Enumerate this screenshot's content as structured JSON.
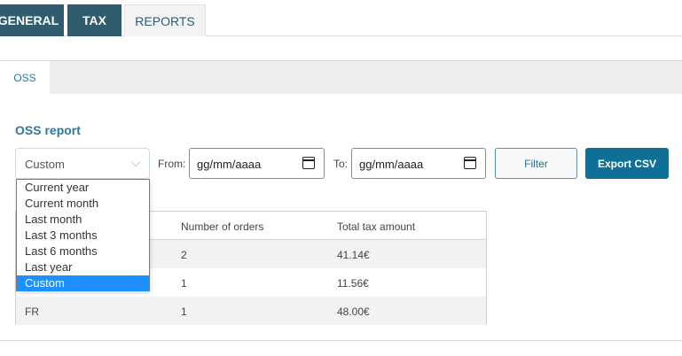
{
  "top_tabs": {
    "general": "GENERAL",
    "tax": "TAX",
    "reports": "REPORTS"
  },
  "sub_tabs": {
    "oss": "OSS"
  },
  "report": {
    "title": "OSS report",
    "period": {
      "selected": "Custom",
      "options": [
        "Current year",
        "Current month",
        "Last month",
        "Last 3 months",
        "Last 6 months",
        "Last year",
        "Custom"
      ]
    },
    "from_label": "From:",
    "from_value": "gg/mm/aaaa",
    "to_label": "To:",
    "to_value": "gg/mm/aaaa",
    "filter_label": "Filter",
    "export_label": "Export CSV"
  },
  "table": {
    "columns": [
      "",
      "Number of orders",
      "Total tax amount"
    ],
    "rows": [
      [
        "",
        "2",
        "41.14€"
      ],
      [
        "",
        "1",
        "11.56€"
      ],
      [
        "FR",
        "1",
        "48.00€"
      ]
    ]
  },
  "colors": {
    "tab_dark": "#2f5d6e",
    "accent": "#2a7aa0",
    "export_button": "#0e7096",
    "selected_option": "#1e90ff"
  }
}
